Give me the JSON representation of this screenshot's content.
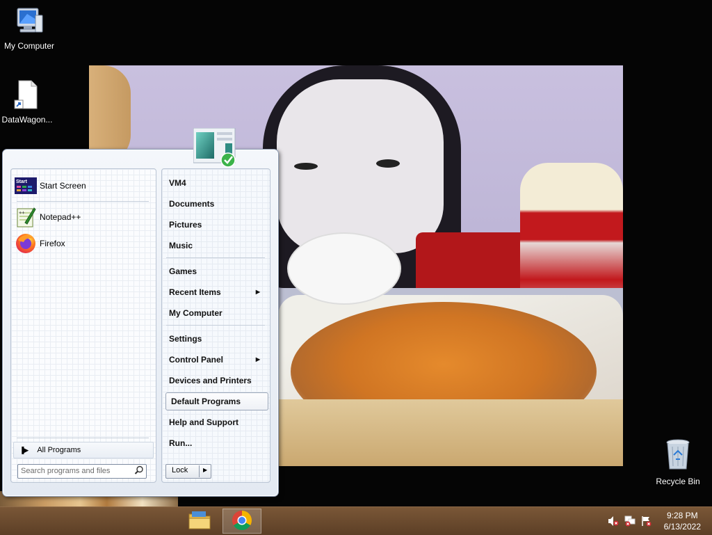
{
  "desktop": {
    "icons": [
      {
        "name": "my-computer",
        "label": "My Computer",
        "icon": "computer-icon"
      },
      {
        "name": "datawagon",
        "label": "DataWagon...",
        "icon": "file-shortcut-icon"
      },
      {
        "name": "recycle-bin",
        "label": "Recycle Bin",
        "icon": "recycle-bin-icon"
      }
    ]
  },
  "start_menu": {
    "pinned": [
      {
        "label": "Start Screen",
        "icon": "start-screen-icon",
        "icon_text": "Start"
      },
      {
        "label": "Notepad++",
        "icon": "notepadpp-icon"
      },
      {
        "label": "Firefox",
        "icon": "firefox-icon"
      }
    ],
    "all_programs_label": "All Programs",
    "search_placeholder": "Search programs and files",
    "right_items": [
      {
        "label": "VM4"
      },
      {
        "label": "Documents"
      },
      {
        "label": "Pictures"
      },
      {
        "label": "Music"
      },
      {
        "label": "Games"
      },
      {
        "label": "Recent Items",
        "has_submenu": true
      },
      {
        "label": "My Computer"
      },
      {
        "label": "Settings"
      },
      {
        "label": "Control Panel",
        "has_submenu": true
      },
      {
        "label": "Devices and Printers"
      },
      {
        "label": "Default Programs",
        "highlighted": true
      },
      {
        "label": "Help and Support"
      },
      {
        "label": "Run..."
      }
    ],
    "lock_label": "Lock"
  },
  "taskbar": {
    "pinned": [
      {
        "name": "file-explorer",
        "icon": "folder-icon",
        "active": false
      },
      {
        "name": "chrome",
        "icon": "chrome-icon",
        "active": true
      }
    ],
    "tray": [
      "volume-muted-icon",
      "network-error-icon",
      "action-center-flag-icon"
    ],
    "clock": {
      "time": "9:28 PM",
      "date": "6/13/2022"
    }
  },
  "colors": {
    "taskbar": "#6b4a2e",
    "menu_border": "#8e9cb3",
    "menu_panel": "#fbfcfe"
  }
}
